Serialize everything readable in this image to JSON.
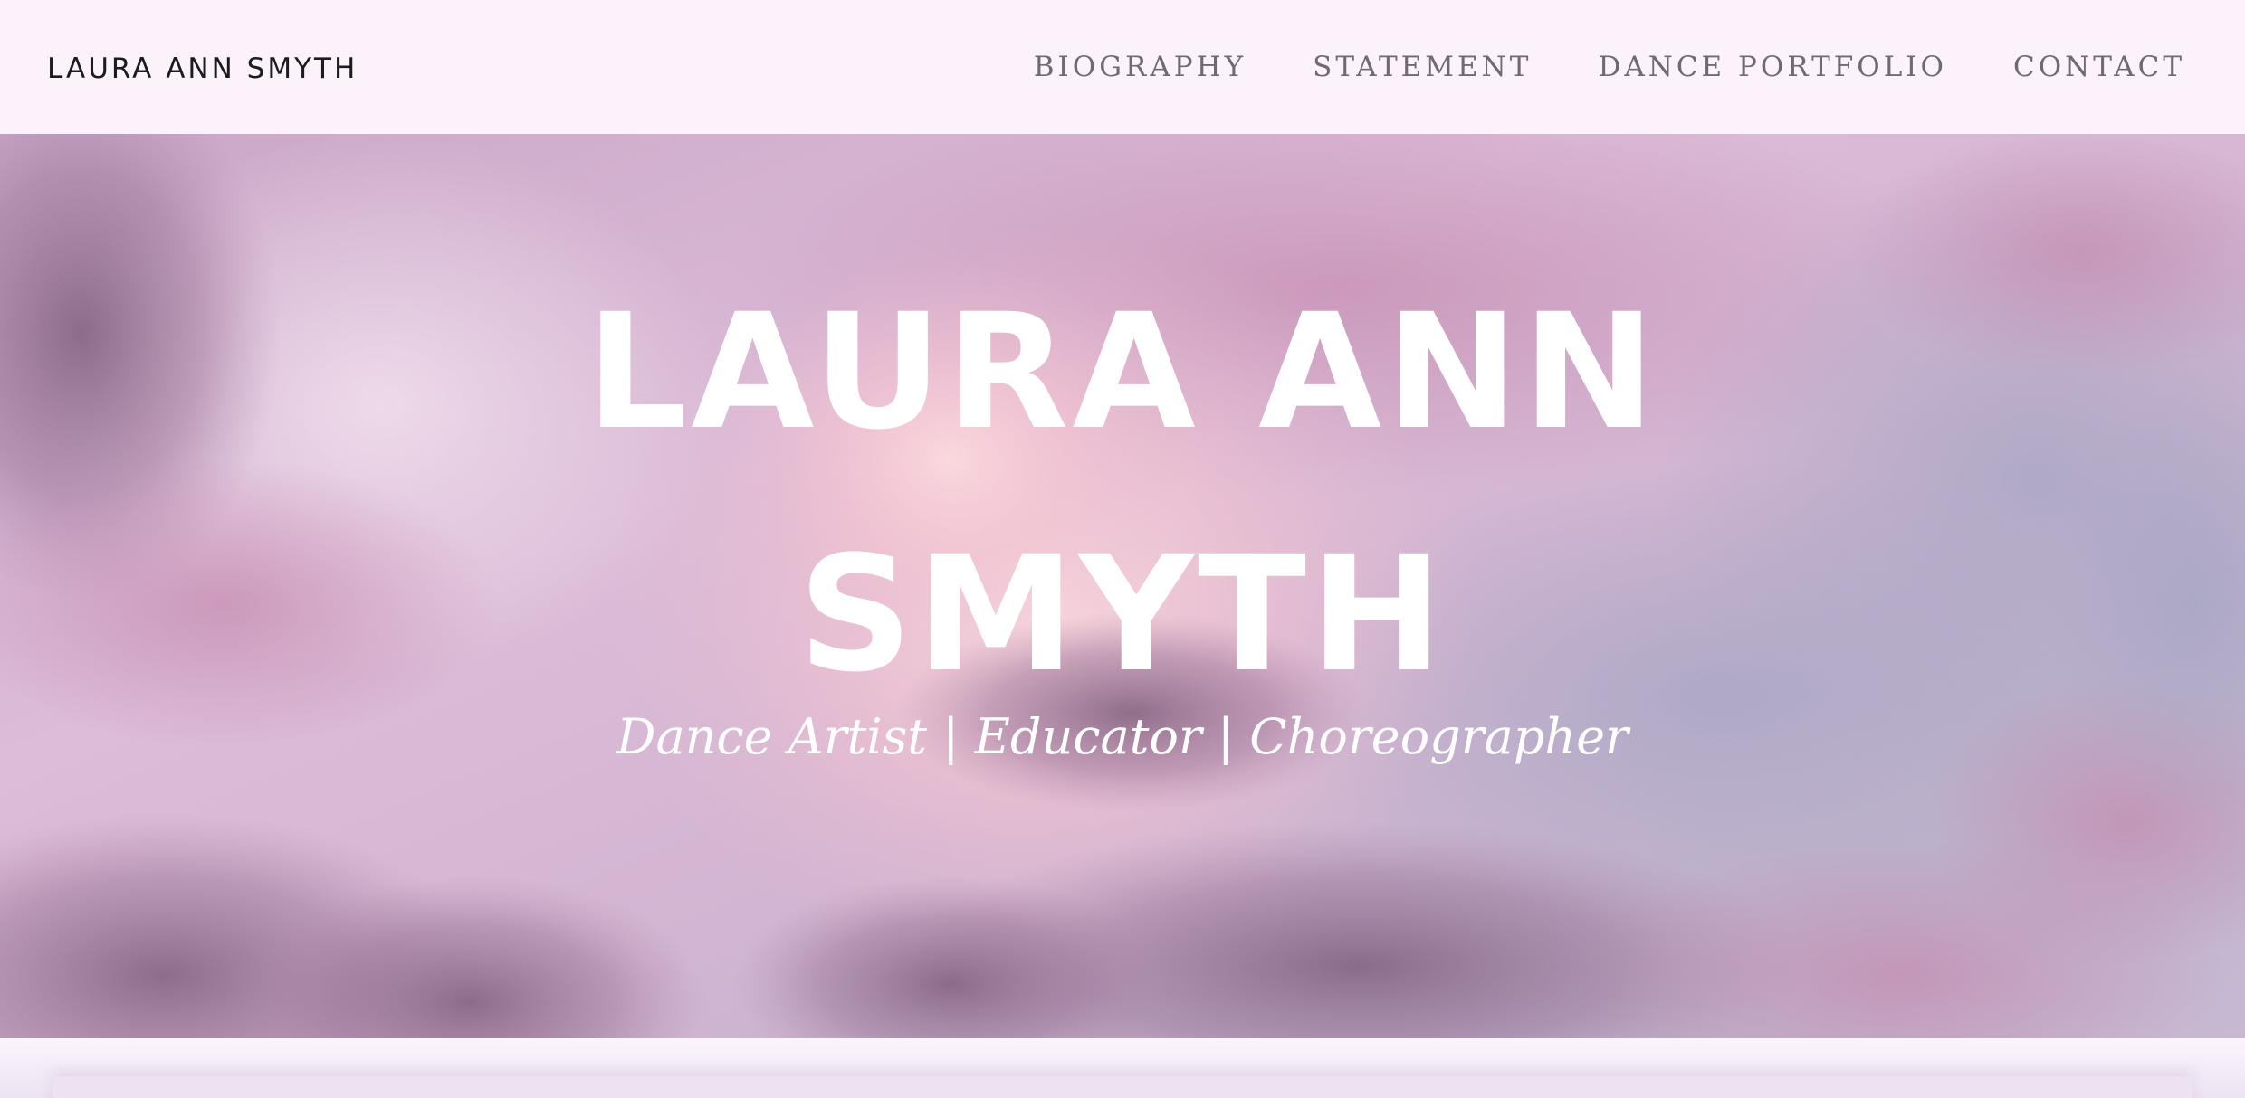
{
  "header": {
    "site_title": "LAURA ANN SMYTH",
    "nav": [
      {
        "label": "BIOGRAPHY"
      },
      {
        "label": "STATEMENT"
      },
      {
        "label": "DANCE PORTFOLIO"
      },
      {
        "label": "CONTACT"
      }
    ]
  },
  "hero": {
    "title_line1": "LAURA ANN",
    "title_line2": "SMYTH",
    "subtitle": "Dance Artist | Educator | Choreographer"
  },
  "colors": {
    "header_bg": "#fbf2fc",
    "nav_text": "#6f6a72",
    "hero_text": "#ffffff"
  }
}
